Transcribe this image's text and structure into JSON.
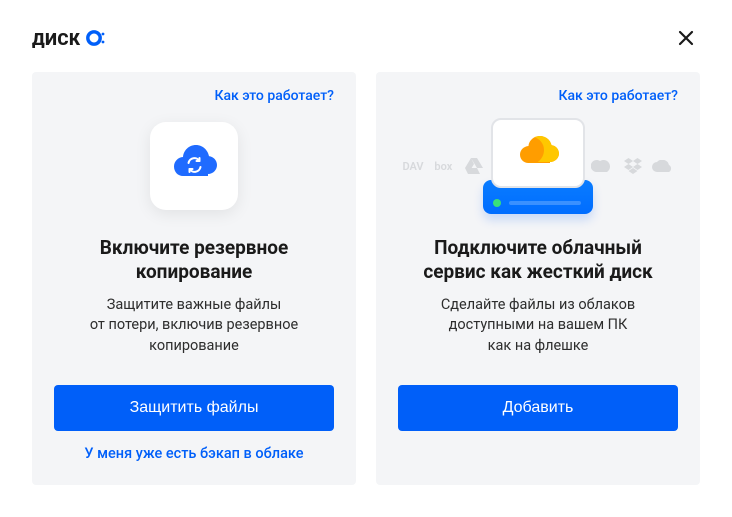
{
  "header": {
    "logo_text": "ДИСК"
  },
  "cards": {
    "backup": {
      "how_link": "Как это работает?",
      "title_line1": "Включите резервное",
      "title_line2": "копирование",
      "sub_line1": "Защитите важные файлы",
      "sub_line2": "от потери, включив резервное",
      "sub_line3": "копирование",
      "primary_label": "Защитить файлы",
      "secondary_label": "У меня уже есть бэкап в облаке"
    },
    "connect": {
      "how_link": "Как это работает?",
      "title_line1": "Подключите облачный",
      "title_line2": "сервис как жесткий диск",
      "sub_line1": "Сделайте файлы из облаков",
      "sub_line2": "доступными на вашем ПК",
      "sub_line3": "как на флешке",
      "primary_label": "Добавить",
      "ghost_labels": {
        "dav": "DAV",
        "box": "box"
      }
    }
  },
  "colors": {
    "primary": "#005ff9",
    "card_bg": "#f4f5f7"
  }
}
